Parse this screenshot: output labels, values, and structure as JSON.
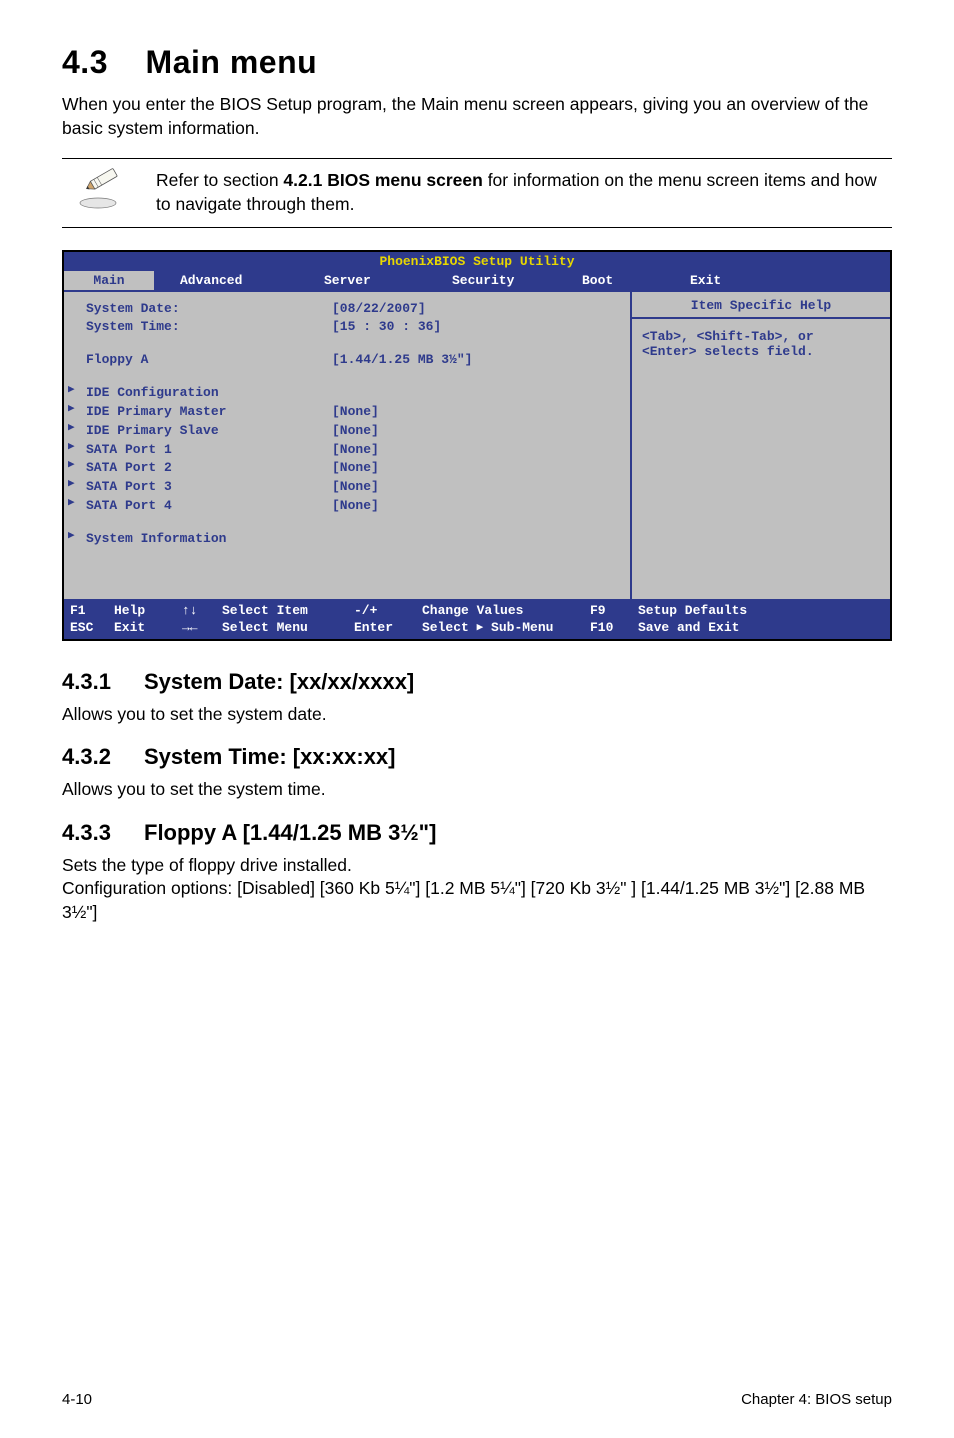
{
  "heading": {
    "num": "4.3",
    "title": "Main menu"
  },
  "intro": "When you enter the BIOS Setup program, the Main menu screen appears, giving you an overview of the basic system information.",
  "note": {
    "prefix": "Refer to section ",
    "bold": "4.2.1 BIOS menu screen",
    "suffix": " for information on the menu screen items and how to navigate through them."
  },
  "bios": {
    "title": "PhoenixBIOS Setup Utility",
    "menu": [
      "Main",
      "Advanced",
      "Server",
      "Security",
      "Boot",
      "Exit"
    ],
    "rows_top": [
      {
        "label": "System Date:",
        "value": "[08/22/2007]"
      },
      {
        "label": "System Time:",
        "value": "[15 : 30 : 36]"
      }
    ],
    "floppy": {
      "label": "Floppy A",
      "value": "[1.44/1.25 MB 3½\"]"
    },
    "rows_list": [
      {
        "label": "IDE Configuration",
        "value": ""
      },
      {
        "label": "IDE Primary Master",
        "value": "[None]"
      },
      {
        "label": "IDE Primary Slave",
        "value": "[None]"
      },
      {
        "label": "SATA Port 1",
        "value": "[None]"
      },
      {
        "label": "SATA Port 2",
        "value": "[None]"
      },
      {
        "label": "SATA Port 3",
        "value": "[None]"
      },
      {
        "label": "SATA Port 4",
        "value": "[None]"
      }
    ],
    "sysinfo": "System Information",
    "help_header": "Item Specific Help",
    "help_body1": "<Tab>, <Shift-Tab>, or",
    "help_body2": "<Enter> selects field.",
    "footer": {
      "r1": {
        "k": "F1",
        "a": "Help",
        "arrow": "↑↓",
        "d": "Select Item",
        "k2": "-/+",
        "d2": "Change Values",
        "k3": "F9",
        "d3": "Setup Defaults"
      },
      "r2": {
        "k": "ESC",
        "a": "Exit",
        "arrow": "→←",
        "d": "Select Menu",
        "k2": "Enter",
        "d2_pre": "Select ",
        "d2_post": " Sub-Menu",
        "k3": "F10",
        "d3": "Save and Exit"
      }
    }
  },
  "sections": [
    {
      "num": "4.3.1",
      "title": "System Date: [xx/xx/xxxx]",
      "body": "Allows you to set the system date."
    },
    {
      "num": "4.3.2",
      "title": "System Time: [xx:xx:xx]",
      "body": "Allows you to set the system time."
    },
    {
      "num": "4.3.3",
      "title": "Floppy A [1.44/1.25 MB 3½\"]",
      "body": "Sets the type of floppy drive installed.\nConfiguration options: [Disabled] [360 Kb  5¼\"] [1.2 MB  5¼\"] [720 Kb  3½\" ] [1.44/1.25 MB  3½\"] [2.88 MB  3½\"]"
    }
  ],
  "pagefooter": {
    "left": "4-10",
    "right": "Chapter 4: BIOS setup"
  }
}
